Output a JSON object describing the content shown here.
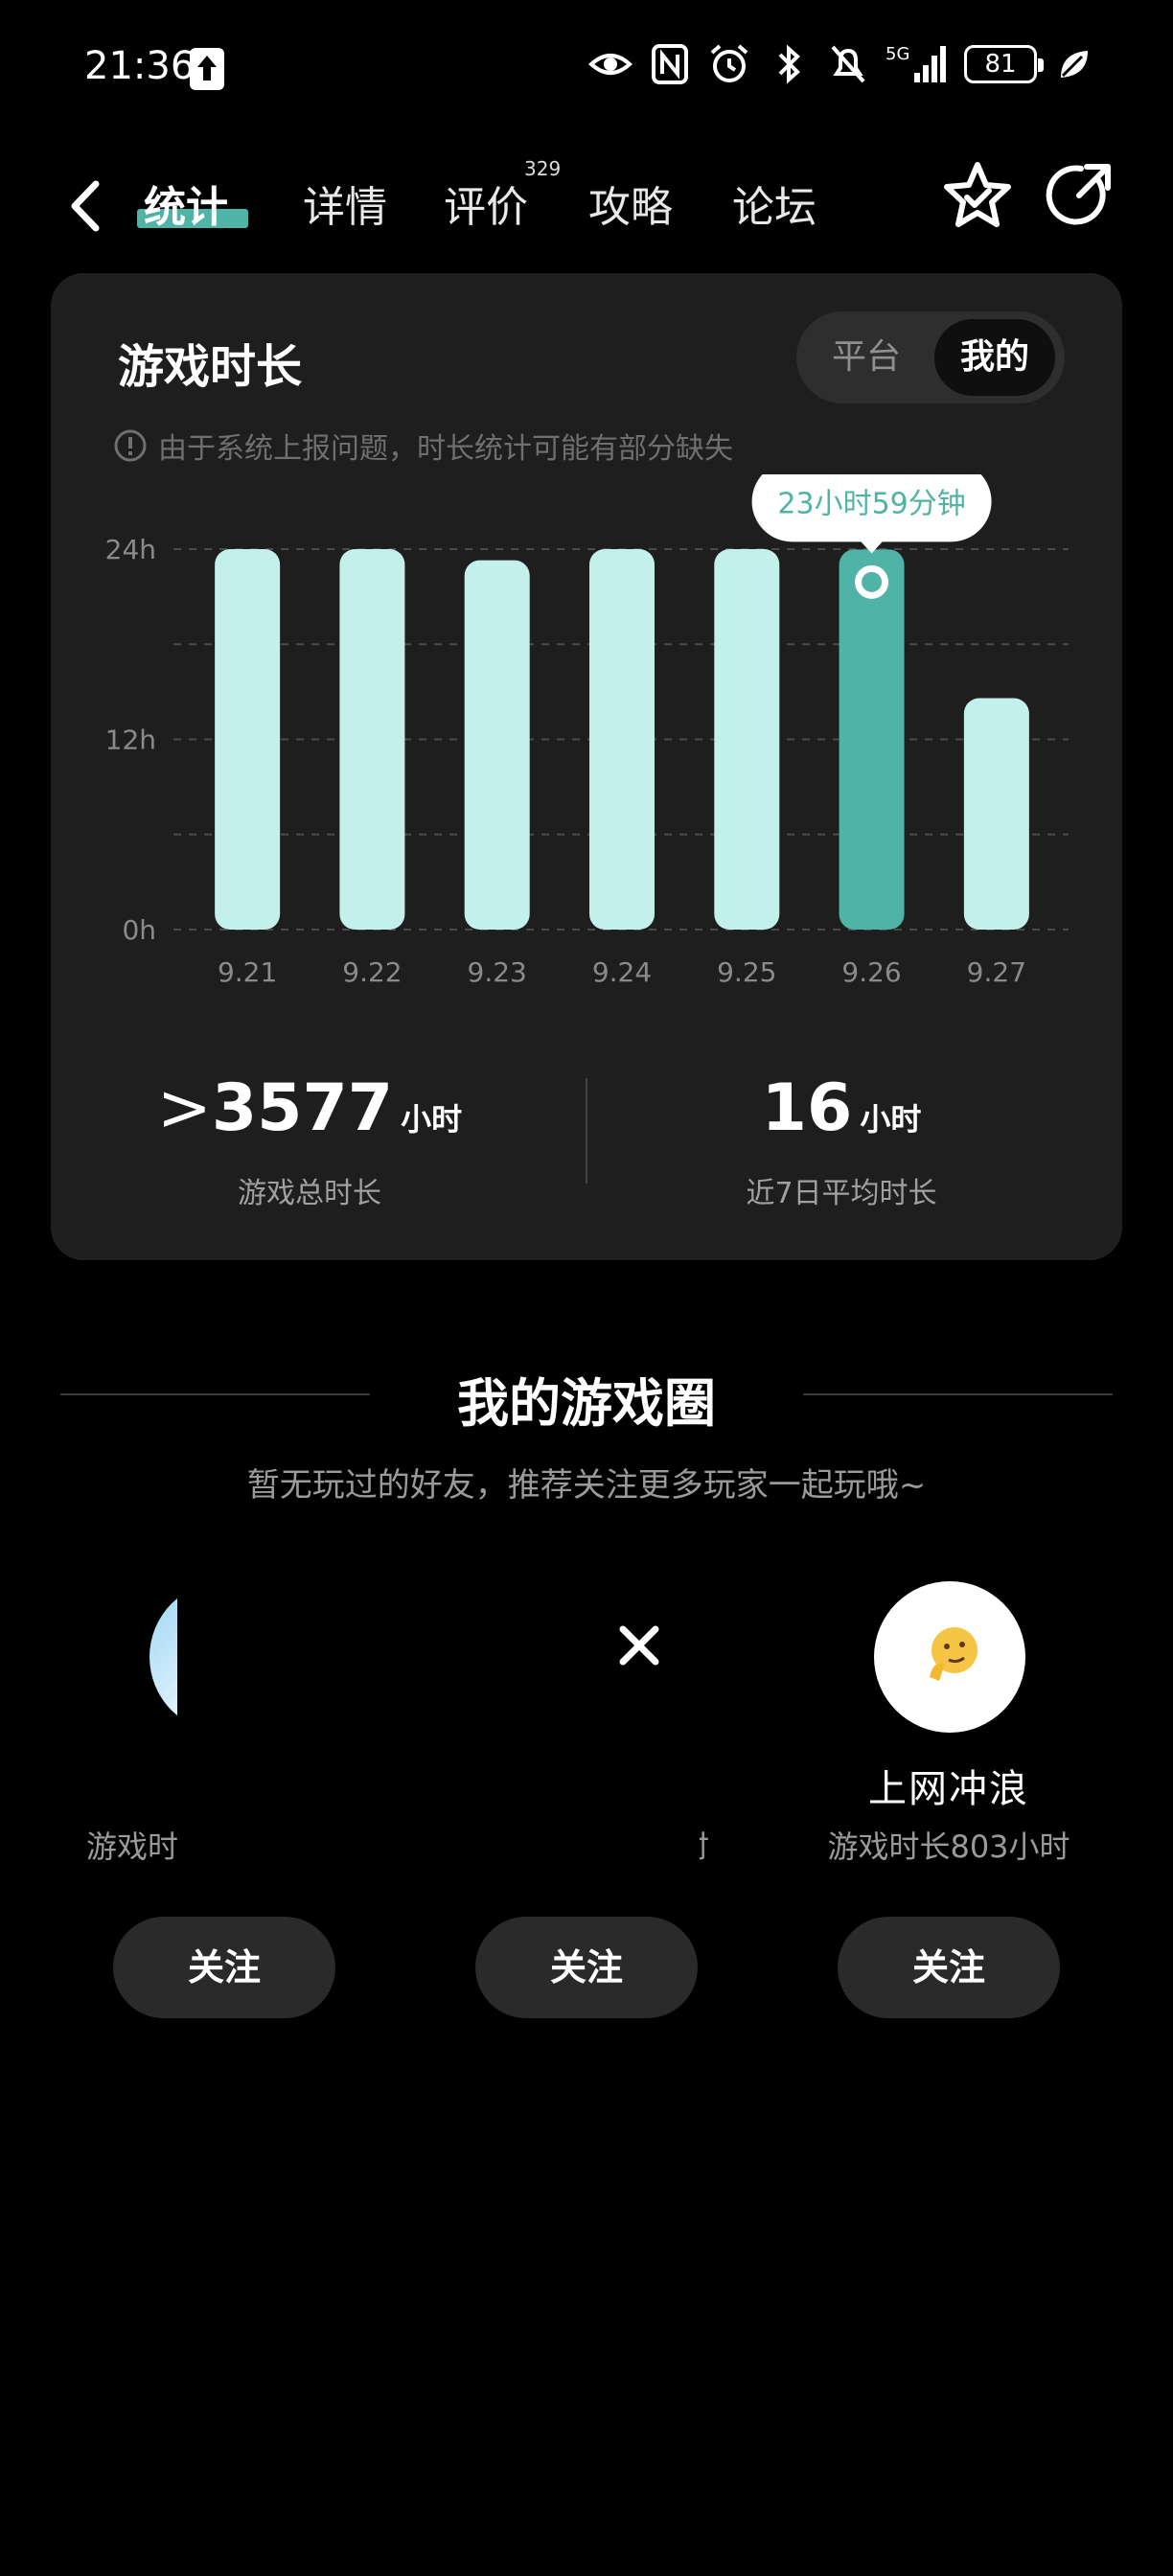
{
  "status_bar": {
    "time": "21:36",
    "battery": "81",
    "network": "5G"
  },
  "header": {
    "tabs": [
      {
        "label": "统计"
      },
      {
        "label": "详情"
      },
      {
        "label": "评价",
        "badge": "329"
      },
      {
        "label": "攻略"
      },
      {
        "label": "论坛"
      }
    ],
    "active_tab": "统计"
  },
  "card": {
    "title": "游戏时长",
    "toggle": {
      "options": [
        "平台",
        "我的"
      ],
      "selected": "我的"
    },
    "notice": "由于系统上报问题，时长统计可能有部分缺失",
    "tooltip": "23小时59分钟",
    "total": {
      "prefix": ">",
      "value": "3577",
      "unit": "小时",
      "label": "游戏总时长"
    },
    "average": {
      "value": "16",
      "unit": "小时",
      "label": "近7日平均时长"
    }
  },
  "chart_data": {
    "type": "bar",
    "categories": [
      "9.21",
      "9.22",
      "9.23",
      "9.24",
      "9.25",
      "9.26",
      "9.27"
    ],
    "values": [
      24,
      24,
      23.3,
      24,
      24,
      23.98,
      14.6
    ],
    "highlight_index": 5,
    "y_ticks": [
      "0h",
      "12h",
      "24h"
    ],
    "ylim": [
      0,
      24
    ],
    "grid": true,
    "colors": {
      "bar": "#c4f0ec",
      "highlight": "#4fb3a6",
      "grid": "#4a4a4a",
      "tooltip_text": "#4fb3a6"
    }
  },
  "circle": {
    "title": "我的游戏圈",
    "subtitle": "暂无玩过的好友，推荐关注更多玩家一起玩哦~",
    "users": [
      {
        "name": "",
        "meta": "游戏时",
        "follow": "关注"
      },
      {
        "name": "",
        "meta": "时",
        "follow": "关注"
      },
      {
        "name": "上网冲浪",
        "meta": "游戏时长803小时",
        "follow": "关注"
      }
    ]
  },
  "colors": {
    "accent": "#4fb3a6",
    "background": "#000000",
    "card": "#1e1e1e"
  }
}
